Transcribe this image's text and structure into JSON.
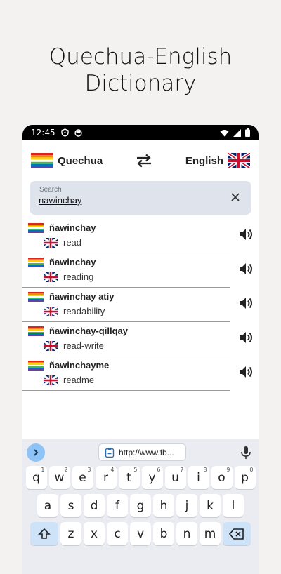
{
  "headline": {
    "line1": "Quechua-English",
    "line2": "Dictionary"
  },
  "status_bar": {
    "time": "12:45"
  },
  "language_bar": {
    "source": "Quechua",
    "target": "English"
  },
  "search": {
    "placeholder": "Search",
    "value": "nawinchay"
  },
  "results": [
    {
      "quechua": "ñawinchay",
      "english": "read"
    },
    {
      "quechua": "ñawinchay",
      "english": "reading"
    },
    {
      "quechua": "ñawinchay atiy",
      "english": "readability"
    },
    {
      "quechua": "ñawinchay-qillqay",
      "english": "read-write"
    },
    {
      "quechua": "ñawinchayme",
      "english": "readme"
    }
  ],
  "keyboard": {
    "suggestion_url": "http://www.fb...",
    "row1": [
      {
        "k": "q",
        "s": "1"
      },
      {
        "k": "w",
        "s": "2"
      },
      {
        "k": "e",
        "s": "3"
      },
      {
        "k": "r",
        "s": "4"
      },
      {
        "k": "t",
        "s": "5"
      },
      {
        "k": "y",
        "s": "6"
      },
      {
        "k": "u",
        "s": "7"
      },
      {
        "k": "i",
        "s": "8"
      },
      {
        "k": "o",
        "s": "9"
      },
      {
        "k": "p",
        "s": "0"
      }
    ],
    "row2": [
      "a",
      "s",
      "d",
      "f",
      "g",
      "h",
      "j",
      "k",
      "l"
    ],
    "row3": [
      "z",
      "x",
      "c",
      "v",
      "b",
      "n",
      "m"
    ]
  },
  "colors": {
    "search_bg": "#dfe4ec",
    "keyboard_bg": "#eaecf2",
    "accent": "#8dc4f5"
  }
}
